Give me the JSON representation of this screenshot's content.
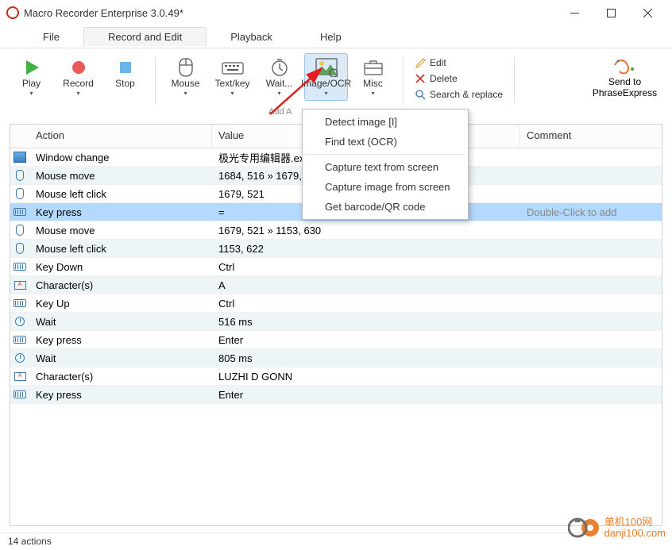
{
  "window": {
    "title": "Macro Recorder Enterprise 3.0.49*"
  },
  "menu": {
    "items": [
      "File",
      "Record and Edit",
      "Playback",
      "Help"
    ],
    "active_index": 1
  },
  "toolbar": {
    "play": "Play",
    "record": "Record",
    "stop": "Stop",
    "mouse": "Mouse",
    "textkey": "Text/key",
    "wait": "Wait...",
    "imageocr": "Image/OCR",
    "misc": "Misc",
    "group_label": "Add A",
    "edit": "Edit",
    "delete": "Delete",
    "searchreplace": "Search & replace",
    "sendto1": "Send to",
    "sendto2": "PhraseExpress"
  },
  "context_menu": {
    "items": [
      "Detect image [I]",
      "Find text (OCR)",
      "—",
      "Capture text from screen",
      "Capture image from screen",
      "Get barcode/QR code"
    ]
  },
  "table": {
    "headers": {
      "action": "Action",
      "value": "Value",
      "comment": "Comment"
    },
    "rows": [
      {
        "icon": "win",
        "action": "Window change",
        "value": "极光专用编辑器.exe"
      },
      {
        "icon": "mouse",
        "action": "Mouse move",
        "value": "1684, 516 » 1679, 5"
      },
      {
        "icon": "mouse",
        "action": "Mouse left click",
        "value": "1679, 521"
      },
      {
        "icon": "kbd",
        "action": "Key press",
        "value": "=",
        "comment": "Double-Click to add",
        "selected": true
      },
      {
        "icon": "mouse",
        "action": "Mouse move",
        "value": "1679, 521 » 1153, 630"
      },
      {
        "icon": "mouse",
        "action": "Mouse left click",
        "value": "1153, 622"
      },
      {
        "icon": "kbd",
        "action": "Key Down",
        "value": "Ctrl"
      },
      {
        "icon": "chars",
        "action": "Character(s)",
        "value": "A"
      },
      {
        "icon": "kbd",
        "action": "Key Up",
        "value": "Ctrl"
      },
      {
        "icon": "wait",
        "action": "Wait",
        "value": "516 ms"
      },
      {
        "icon": "kbd",
        "action": "Key press",
        "value": "Enter"
      },
      {
        "icon": "wait",
        "action": "Wait",
        "value": "805 ms"
      },
      {
        "icon": "chars",
        "action": "Character(s)",
        "value": "LUZHI D GONN"
      },
      {
        "icon": "kbd",
        "action": "Key press",
        "value": "Enter"
      }
    ]
  },
  "status": {
    "text": "14 actions"
  },
  "watermark": {
    "line1": "单机100网",
    "line2": "danji100.com"
  }
}
